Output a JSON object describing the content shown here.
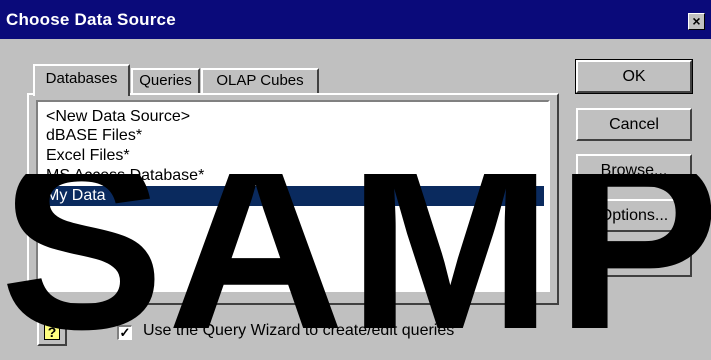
{
  "window": {
    "title": "Choose Data Source",
    "close_icon": "close-icon"
  },
  "tabs": [
    {
      "label": "Databases",
      "active": true
    },
    {
      "label": "Queries",
      "active": false
    },
    {
      "label": "OLAP Cubes",
      "active": false
    }
  ],
  "list": {
    "items": [
      {
        "label": "<New Data Source>",
        "selected": false
      },
      {
        "label": "dBASE Files*",
        "selected": false
      },
      {
        "label": "Excel Files*",
        "selected": false
      },
      {
        "label": "MS Access Database*",
        "selected": false
      },
      {
        "label": "My Data",
        "selected": true
      }
    ]
  },
  "buttons": {
    "ok": "OK",
    "cancel": "Cancel",
    "browse": "Browse...",
    "options": "Options...",
    "delete": "Delete"
  },
  "help_icon": "help-icon",
  "wizard_checkbox": {
    "label": "Use the Query Wizard to create/edit queries",
    "checked": true
  },
  "watermark": "SAMPLE",
  "colors": {
    "title_bar": "#0a0a7a",
    "selection": "#0a2a5e",
    "face": "#c0c0c0"
  }
}
